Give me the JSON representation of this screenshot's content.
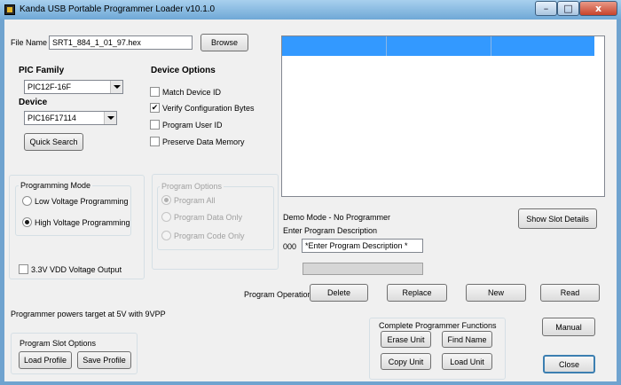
{
  "window": {
    "title": "Kanda USB Portable Programmer Loader v10.1.0"
  },
  "file": {
    "label": "File Name",
    "value": "SRT1_884_1_01_97.hex",
    "browse": "Browse"
  },
  "pic_family": {
    "label": "PIC Family",
    "value": "PIC12F-16F"
  },
  "device": {
    "label": "Device",
    "value": "PIC16F17114"
  },
  "quick_search": "Quick Search",
  "device_options": {
    "heading": "Device Options",
    "match_device_id": "Match Device ID",
    "verify_config": "Verify Configuration Bytes",
    "program_user_id": "Program User ID",
    "preserve_data": "Preserve Data Memory"
  },
  "programming_mode": {
    "label": "Programming Mode",
    "low": "Low Voltage Programming",
    "high": "High Voltage Programming"
  },
  "vdd_output": "3.3V VDD Voltage Output",
  "program_options": {
    "label": "Program Options",
    "all": "Program All",
    "data_only": "Program Data Only",
    "code_only": "Program Code Only"
  },
  "status": {
    "demo_mode": "Demo Mode - No Programmer",
    "enter_desc": "Enter Program Description",
    "slot_number": "000",
    "desc_value": "*Enter Program Description *"
  },
  "show_slot_details": "Show Slot Details",
  "program_operations": {
    "label": "Program Operations",
    "delete": "Delete",
    "replace": "Replace",
    "new": "New",
    "read": "Read"
  },
  "powers_text": "Programmer powers target at 5V with 9VPP",
  "slot_options": {
    "label": "Program Slot Options",
    "load": "Load Profile",
    "save": "Save Profile"
  },
  "complete_functions": {
    "label": "Complete Programmer Functions",
    "erase": "Erase Unit",
    "find": "Find Name",
    "copy": "Copy Unit",
    "load": "Load Unit"
  },
  "manual": "Manual",
  "close": "Close",
  "titlebar_buttons": {
    "minimize": "–",
    "maximize": "□",
    "close": "x"
  }
}
